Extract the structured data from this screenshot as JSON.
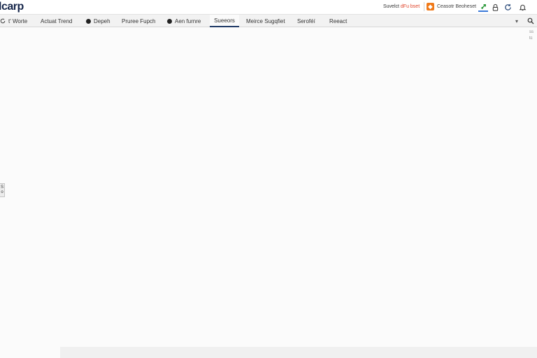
{
  "header": {
    "brand": "lcarp",
    "search_link_prefix": "Suvelct ",
    "search_link_accent": "dFu bset",
    "feature_label": "Ceasotr Beoheset",
    "feature_icon": "cube-icon",
    "icons": [
      "pin-icon",
      "lock-icon",
      "refresh-icon",
      "bell-icon"
    ],
    "accent_color": "#3b7ad8",
    "brand_color": "#16264a"
  },
  "tabs": [
    {
      "label": "t' Worte",
      "icon": "refresh-icon"
    },
    {
      "label": "Actuat Trend",
      "icon": ""
    },
    {
      "label": "Depeh",
      "icon": "dot-icon"
    },
    {
      "label": "Pruree Fupch",
      "icon": ""
    },
    {
      "label": "Aen furnre",
      "icon": "dot-icon"
    },
    {
      "label": "Sueeors",
      "icon": "",
      "active": true
    },
    {
      "label": "Meirce Sugqfiet",
      "icon": ""
    },
    {
      "label": "Seroféí",
      "icon": ""
    },
    {
      "label": "Reeact",
      "icon": ""
    }
  ],
  "tab_controls": {
    "dropdown_icon": "chevron-down-icon",
    "search_icon": "search-icon"
  },
  "side_text": [
    "ss",
    "tc"
  ],
  "edge_widget": {
    "line1": "S",
    "line2": "o"
  }
}
